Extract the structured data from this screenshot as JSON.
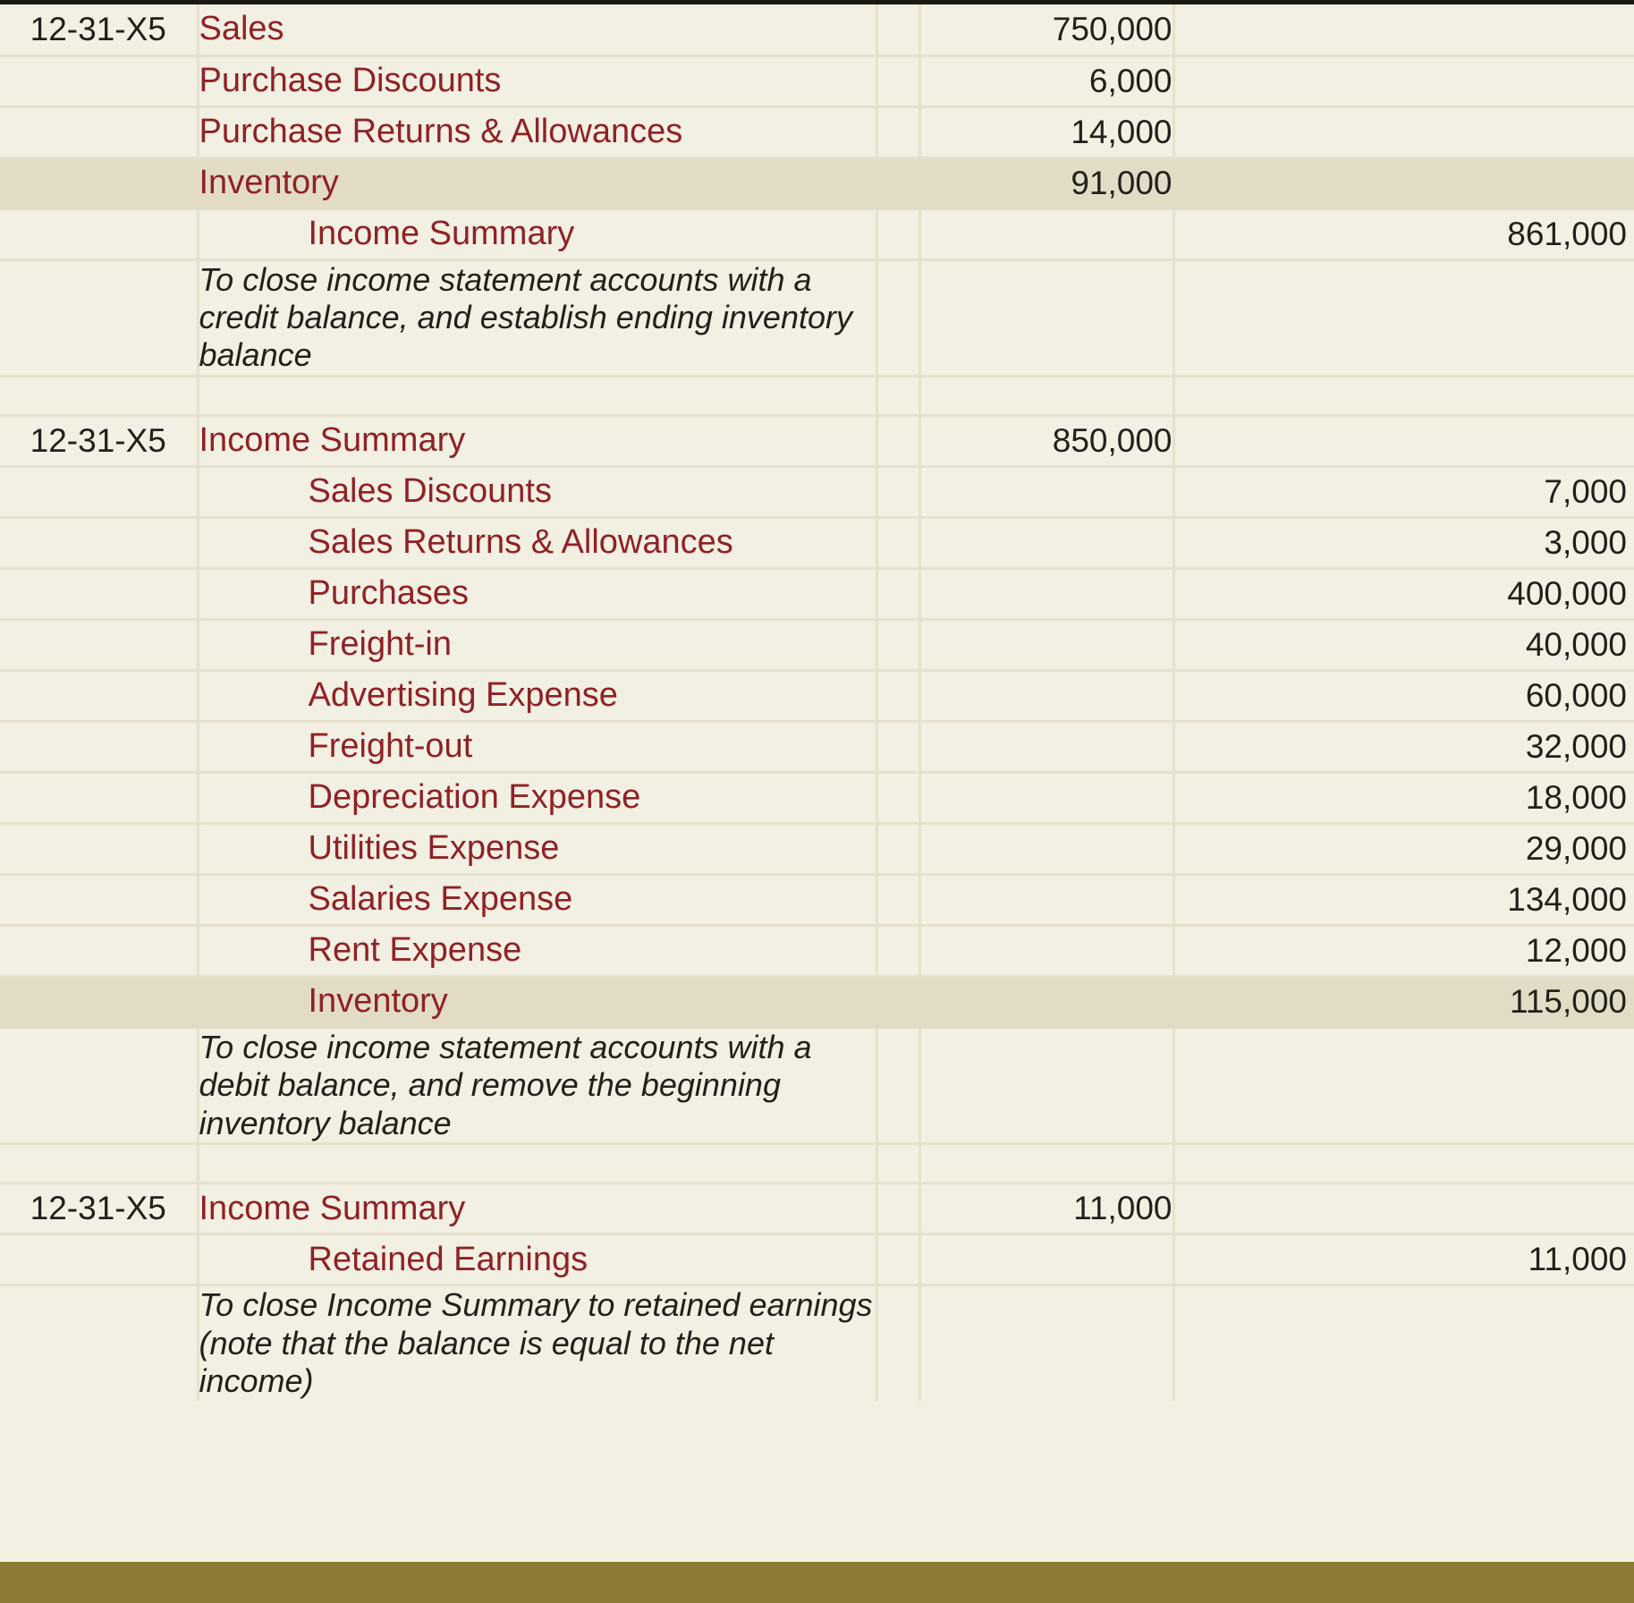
{
  "document": {
    "kind": "general-journal",
    "accent_red": "#8f2225",
    "background": "#f2efe3",
    "highlight": "#e2dcc6",
    "bottom_bar": "#8c7a35",
    "top_rule": "#1a1a14"
  },
  "rows": [
    {
      "type": "entry",
      "date": "12-31-X5",
      "account": "Sales",
      "indent": "debit",
      "debit": "750,000",
      "credit": "",
      "highlight": false
    },
    {
      "type": "entry",
      "date": "",
      "account": "Purchase Discounts",
      "indent": "debit",
      "debit": "6,000",
      "credit": "",
      "highlight": false
    },
    {
      "type": "entry",
      "date": "",
      "account": "Purchase Returns & Allowances",
      "indent": "debit",
      "debit": "14,000",
      "credit": "",
      "highlight": false
    },
    {
      "type": "entry",
      "date": "",
      "account": "Inventory",
      "indent": "debit",
      "debit": "91,000",
      "credit": "",
      "highlight": true
    },
    {
      "type": "entry",
      "date": "",
      "account": "Income Summary",
      "indent": "credit",
      "debit": "",
      "credit": "861,000",
      "highlight": false
    },
    {
      "type": "desc",
      "text": "To close income statement accounts with a credit balance, and establish ending inventory balance"
    },
    {
      "type": "spacer"
    },
    {
      "type": "entry",
      "date": "12-31-X5",
      "account": "Income Summary",
      "indent": "debit",
      "debit": "850,000",
      "credit": "",
      "highlight": false
    },
    {
      "type": "entry",
      "date": "",
      "account": "Sales Discounts",
      "indent": "credit",
      "debit": "",
      "credit": "7,000",
      "highlight": false
    },
    {
      "type": "entry",
      "date": "",
      "account": "Sales Returns & Allowances",
      "indent": "credit",
      "debit": "",
      "credit": "3,000",
      "highlight": false
    },
    {
      "type": "entry",
      "date": "",
      "account": "Purchases",
      "indent": "credit",
      "debit": "",
      "credit": "400,000",
      "highlight": false
    },
    {
      "type": "entry",
      "date": "",
      "account": "Freight-in",
      "indent": "credit",
      "debit": "",
      "credit": "40,000",
      "highlight": false
    },
    {
      "type": "entry",
      "date": "",
      "account": "Advertising Expense",
      "indent": "credit",
      "debit": "",
      "credit": "60,000",
      "highlight": false
    },
    {
      "type": "entry",
      "date": "",
      "account": "Freight-out",
      "indent": "credit",
      "debit": "",
      "credit": "32,000",
      "highlight": false
    },
    {
      "type": "entry",
      "date": "",
      "account": "Depreciation Expense",
      "indent": "credit",
      "debit": "",
      "credit": "18,000",
      "highlight": false
    },
    {
      "type": "entry",
      "date": "",
      "account": "Utilities Expense",
      "indent": "credit",
      "debit": "",
      "credit": "29,000",
      "highlight": false
    },
    {
      "type": "entry",
      "date": "",
      "account": "Salaries Expense",
      "indent": "credit",
      "debit": "",
      "credit": "134,000",
      "highlight": false
    },
    {
      "type": "entry",
      "date": "",
      "account": "Rent Expense",
      "indent": "credit",
      "debit": "",
      "credit": "12,000",
      "highlight": false
    },
    {
      "type": "entry",
      "date": "",
      "account": "Inventory",
      "indent": "credit",
      "debit": "",
      "credit": "115,000",
      "highlight": true
    },
    {
      "type": "desc",
      "text": "To close income statement accounts with a debit balance, and remove the beginning inventory balance"
    },
    {
      "type": "spacer"
    },
    {
      "type": "entry",
      "date": "12-31-X5",
      "account": "Income Summary",
      "indent": "debit",
      "debit": "11,000",
      "credit": "",
      "highlight": false
    },
    {
      "type": "entry",
      "date": "",
      "account": "Retained Earnings",
      "indent": "credit",
      "debit": "",
      "credit": "11,000",
      "highlight": false
    },
    {
      "type": "desc",
      "text": "To close Income Summary to retained earnings (note that the balance is equal to the net income)"
    }
  ]
}
